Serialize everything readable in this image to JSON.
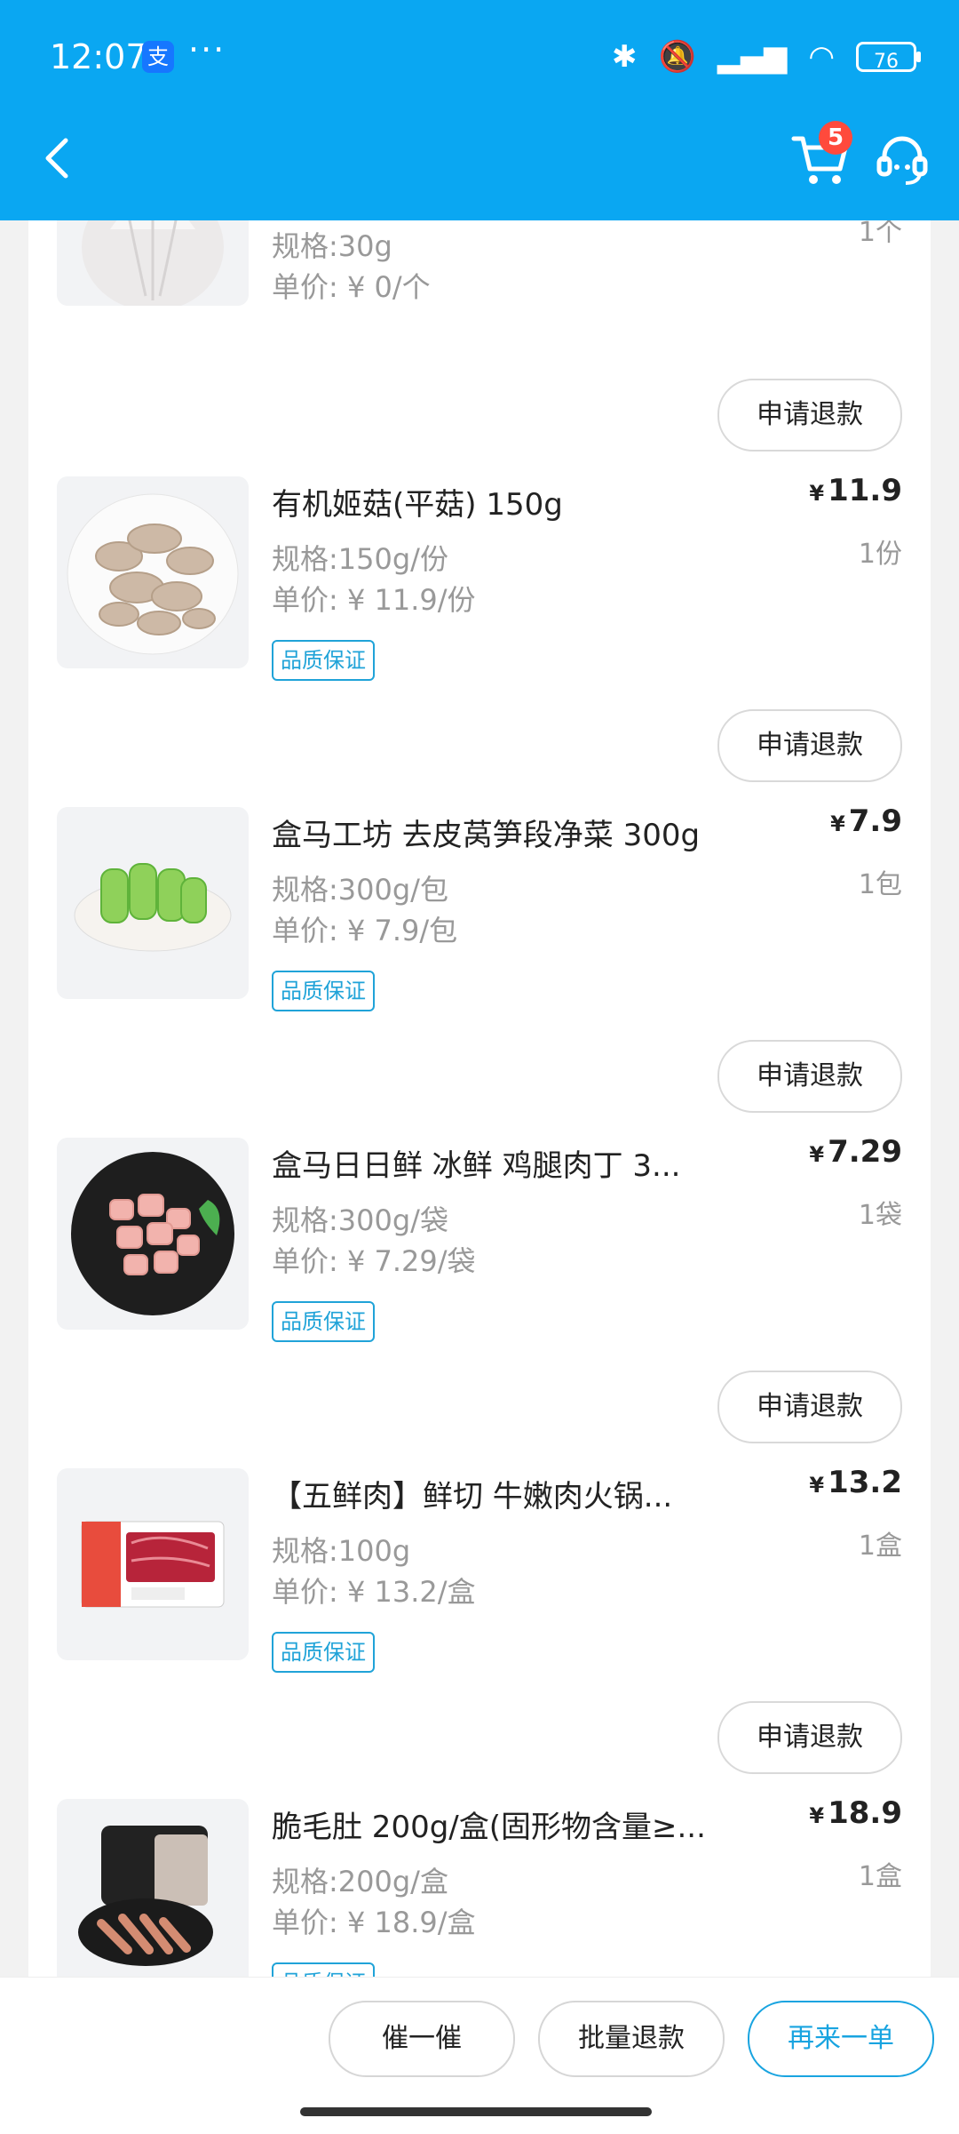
{
  "status_bar": {
    "time": "12:07",
    "app_icon_char": "支",
    "more": "···",
    "battery": "76"
  },
  "header": {
    "cart_badge": "5"
  },
  "items": [
    {
      "spec": "规格:30g",
      "unit_price": "单价: ¥ 0/个",
      "qty": "1个"
    },
    {
      "title": "有机姬菇(平菇) 150g",
      "price": "11.9",
      "spec": "规格:150g/份",
      "unit_price": "单价: ¥ 11.9/份",
      "qty": "1份",
      "tag": "品质保证"
    },
    {
      "title": "盒马工坊 去皮莴笋段净菜 300g",
      "price": "7.9",
      "spec": "规格:300g/包",
      "unit_price": "单价: ¥ 7.9/包",
      "qty": "1包",
      "tag": "品质保证"
    },
    {
      "title": "盒马日日鲜 冰鲜 鸡腿肉丁 3...",
      "price": "7.29",
      "spec": "规格:300g/袋",
      "unit_price": "单价: ¥ 7.29/袋",
      "qty": "1袋",
      "tag": "品质保证"
    },
    {
      "title": "【五鲜肉】鲜切 牛嫩肉火锅...",
      "price": "13.2",
      "spec": "规格:100g",
      "unit_price": "单价: ¥ 13.2/盒",
      "qty": "1盒",
      "tag": "品质保证"
    },
    {
      "title": "脆毛肚 200g/盒(固形物含量≥...",
      "price": "18.9",
      "spec": "规格:200g/盒",
      "unit_price": "单价: ¥ 18.9/盒",
      "qty": "1盒",
      "tag": "品质保证"
    }
  ],
  "refund_label": "申请退款",
  "currency": "¥",
  "bottom": {
    "urge": "催一催",
    "batch_refund": "批量退款",
    "reorder": "再来一单"
  },
  "colors": {
    "header_bg": "#0aa7f2",
    "accent": "#19a4e0",
    "badge": "#ff4a3c"
  }
}
